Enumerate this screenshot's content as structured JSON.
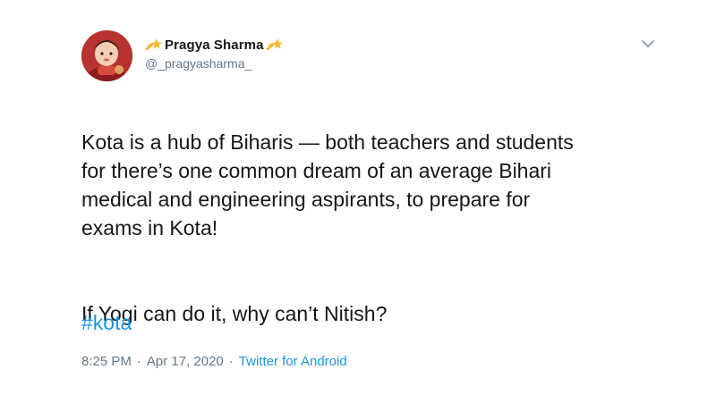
{
  "user": {
    "display_name": "Pragya Sharma",
    "handle": "@_pragyasharma_",
    "decoration_icon": "shooting-star-emoji"
  },
  "tweet": {
    "paragraph_1": "Kota is a hub of Biharis — both teachers and students\nfor there’s one common dream of an average Bihari\nmedical and engineering aspirants, to prepare for\nexams in Kota!",
    "paragraph_2": "If Yogi can do it, why can’t Nitish?",
    "hashtag": "#kota",
    "time": "8:25 PM",
    "date": "Apr 17, 2020",
    "separator": "·",
    "source": "Twitter for Android"
  },
  "colors": {
    "link": "#1b95e0",
    "muted": "#657786",
    "text": "#14171a"
  }
}
